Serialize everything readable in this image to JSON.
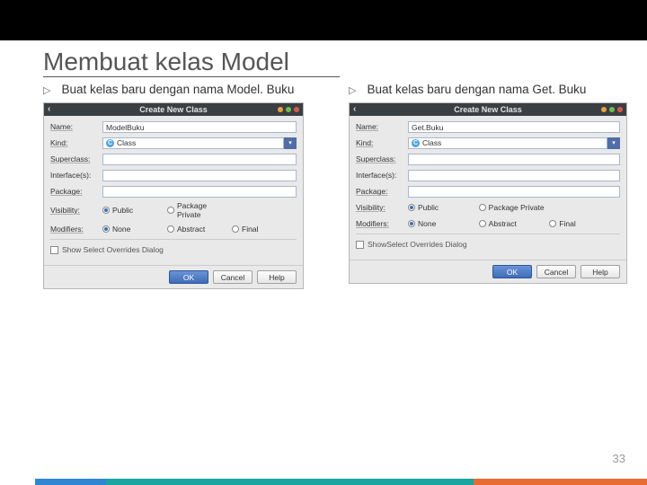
{
  "title": "Membuat kelas Model",
  "page": "33",
  "left": {
    "bullet": "▷",
    "text": "Buat kelas baru dengan nama Model. Buku",
    "dialog_title": "Create New Class",
    "name_label": "Name:",
    "name_value": "ModelBuku",
    "kind_label": "Kind:",
    "kind_value": "Class",
    "super_label": "Superclass:",
    "iface_label": "Interface(s):",
    "pkg_label": "Package:",
    "vis_label": "Visibility:",
    "vis_public": "Public",
    "vis_pp": "Package Private",
    "mod_label": "Modifiers:",
    "mod_none": "None",
    "mod_abstract": "Abstract",
    "mod_final": "Final",
    "chk_label": "Show Select Overrides Dialog",
    "btn_ok": "OK",
    "btn_cancel": "Cancel",
    "btn_help": "Help"
  },
  "right": {
    "bullet": "▷",
    "text": "Buat kelas baru dengan nama Get. Buku",
    "dialog_title": "Create New Class",
    "name_label": "Name:",
    "name_value": "Get.Buku",
    "kind_label": "Kind:",
    "kind_value": "Class",
    "super_label": "Superclass:",
    "iface_label": "Interface(s):",
    "pkg_label": "Package:",
    "vis_label": "Visibility:",
    "vis_public": "Public",
    "vis_pp": "Package Private",
    "mod_label": "Modifiers:",
    "mod_none": "None",
    "mod_abstract": "Abstract",
    "mod_final": "Final",
    "chk_label": "ShowSelect Overrides Dialog",
    "btn_ok": "OK",
    "btn_cancel": "Cancel",
    "btn_help": "Help"
  }
}
